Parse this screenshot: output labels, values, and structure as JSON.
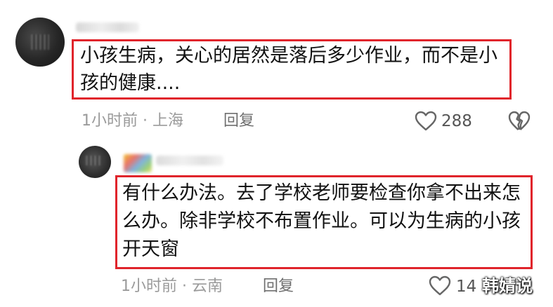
{
  "comments": [
    {
      "text": "小孩生病，关心的居然是落后多少作业，而不是小孩的健康....",
      "time_location": "1小时前 · 上海",
      "reply_label": "回复",
      "likes": "288",
      "icons": {
        "like": "heart-outline-icon",
        "dislike": "broken-heart-icon"
      }
    },
    {
      "text": "有什么办法。去了学校老师要检查你拿不出来怎么办。除非学校不布置作业。可以为生病的小孩开天窗",
      "time_location": "1小时前 · 云南",
      "reply_label": "回复",
      "likes": "14",
      "icons": {
        "like": "heart-outline-icon"
      }
    }
  ],
  "watermark": "韩婧说",
  "colors": {
    "highlight_border": "#e0242b",
    "meta_text": "#9a9a9a",
    "body_text": "#111111"
  }
}
